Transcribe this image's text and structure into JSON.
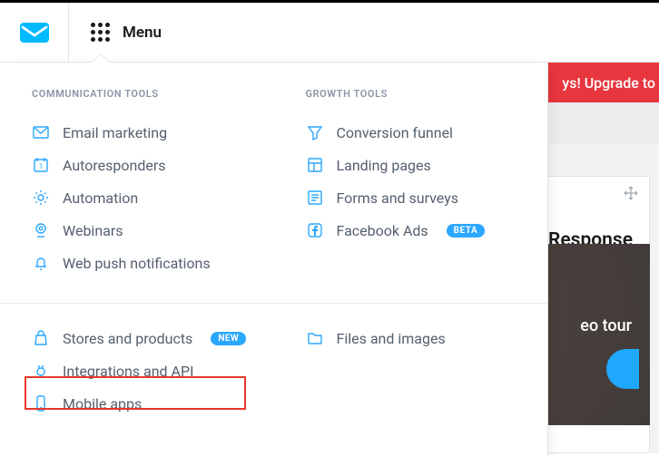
{
  "header": {
    "menu_label": "Menu"
  },
  "menu": {
    "section1_title": "COMMUNICATION TOOLS",
    "section2_title": "GROWTH TOOLS",
    "communication": [
      {
        "label": "Email marketing",
        "icon": "envelope-icon"
      },
      {
        "label": "Autoresponders",
        "icon": "calendar-icon"
      },
      {
        "label": "Automation",
        "icon": "gear-icon"
      },
      {
        "label": "Webinars",
        "icon": "webcam-icon"
      },
      {
        "label": "Web push notifications",
        "icon": "bell-icon"
      }
    ],
    "growth": [
      {
        "label": "Conversion funnel",
        "icon": "funnel-icon"
      },
      {
        "label": "Landing pages",
        "icon": "layout-icon"
      },
      {
        "label": "Forms and surveys",
        "icon": "form-icon"
      },
      {
        "label": "Facebook Ads",
        "icon": "facebook-icon",
        "badge": "BETA"
      }
    ],
    "bottom_left": [
      {
        "label": "Stores and products",
        "icon": "bag-icon",
        "badge": "NEW"
      },
      {
        "label": "Integrations and API",
        "icon": "plug-icon"
      },
      {
        "label": "Mobile apps",
        "icon": "phone-icon"
      }
    ],
    "bottom_right": [
      {
        "label": "Files and images",
        "icon": "folder-icon"
      }
    ]
  },
  "background": {
    "banner_text": "ys! Upgrade to",
    "panel_title": "Response",
    "video_text": "eo tour"
  }
}
